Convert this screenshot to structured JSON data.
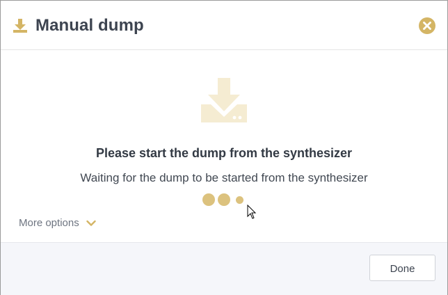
{
  "dialog": {
    "title": "Manual dump",
    "title_icon": "download-icon",
    "close_icon": "close-circle-icon"
  },
  "main": {
    "illustration_icon": "download-tray-icon",
    "heading": "Please start the dump from the synthesizer",
    "message": "Waiting for the dump to be started from the synthesizer",
    "loading_indicator": "loading-dots"
  },
  "more_options": {
    "label": "More options",
    "icon": "chevron-down-icon"
  },
  "footer": {
    "done_label": "Done"
  },
  "colors": {
    "accent": "#d4b565",
    "accent_light": "#f5ecd2",
    "title_text": "#3d4450",
    "footer_bg": "#f5f6fa"
  }
}
